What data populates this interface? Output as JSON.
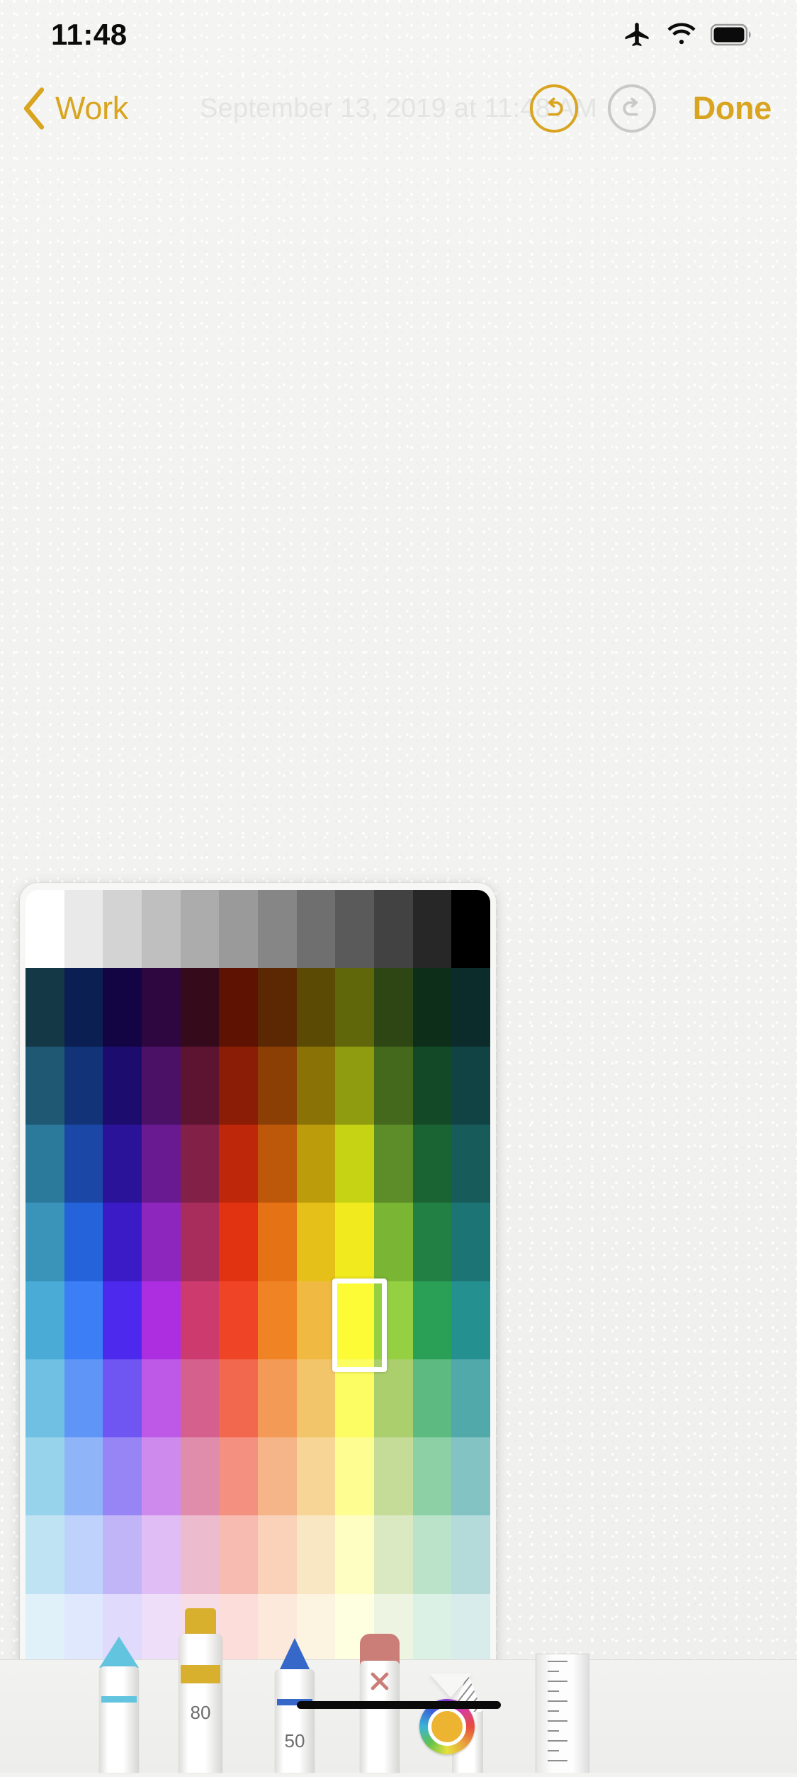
{
  "statusbar": {
    "time": "11:48",
    "icons": [
      "airplane-mode-icon",
      "wifi-icon",
      "battery-icon"
    ]
  },
  "navbar": {
    "back_label": "Work",
    "back_icon": "chevron-left-icon",
    "undo_icon": "undo-arrow-icon",
    "undo_color": "#d9a520",
    "undo_enabled": "true",
    "redo_icon": "redo-arrow-icon",
    "redo_color": "#c9c9c9",
    "redo_enabled": "false",
    "done_label": "Done",
    "accent_color": "#d9a520"
  },
  "note": {
    "timestamp": "September 13, 2019 at 11:48 AM",
    "body": ""
  },
  "color_picker": {
    "columns": 12,
    "rows": 10,
    "selected_index": {
      "row": 5,
      "col": 8
    },
    "selected_color": "#f0b942",
    "grid": [
      [
        "#ffffff",
        "#e9e9e9",
        "#d3d3d3",
        "#bfbfbf",
        "#acacac",
        "#9a9a9a",
        "#868686",
        "#6f6f6f",
        "#5a5a5a",
        "#424242",
        "#272727",
        "#000000"
      ],
      [
        "#143846",
        "#0b1f52",
        "#130544",
        "#2e0740",
        "#350a1b",
        "#5e1202",
        "#5b2803",
        "#5a4a04",
        "#60660a",
        "#2d4613",
        "#0d2f1a",
        "#0c2c2c"
      ],
      [
        "#1f5872",
        "#123377",
        "#1c0c6e",
        "#4a1166",
        "#5c1431",
        "#8b1c05",
        "#8b3f05",
        "#8a7206",
        "#909c0f",
        "#44691d",
        "#134926",
        "#114344"
      ],
      [
        "#2b7a9c",
        "#1b48a7",
        "#2a1299",
        "#6a1a90",
        "#822047",
        "#be2709",
        "#bd570a",
        "#bd9c0c",
        "#c6d314",
        "#5c8d28",
        "#1a6434",
        "#175b5b"
      ],
      [
        "#3a93b8",
        "#2463d9",
        "#3a1bc6",
        "#8c26bc",
        "#a82d5c",
        "#e13312",
        "#e57214",
        "#e5c019",
        "#f0ea1f",
        "#7ab533",
        "#228044",
        "#1d7474"
      ],
      [
        "#49abd6",
        "#3b7ef5",
        "#4c29ec",
        "#ac2ee0",
        "#cd3a6e",
        "#ef4426",
        "#f08424",
        "#f0b942",
        "#fcfb35",
        "#95d042",
        "#2aa057",
        "#249090"
      ],
      [
        "#6fc0e3",
        "#5f95f7",
        "#6f55f2",
        "#bd58e7",
        "#d6608d",
        "#f1684f",
        "#f39a57",
        "#f3c56a",
        "#fcfc63",
        "#accf6d",
        "#5dbb81",
        "#52a9a9"
      ],
      [
        "#97d3eb",
        "#8fb4f8",
        "#9785f5",
        "#cf8aed",
        "#e08cab",
        "#f49080",
        "#f6b489",
        "#f6d596",
        "#fdfd92",
        "#c4dc98",
        "#8dd0a6",
        "#84c3c3"
      ],
      [
        "#c0e3f3",
        "#bed2fb",
        "#c1b5f8",
        "#e0bdf4",
        "#ecbbcd",
        "#f8bbb2",
        "#f9d2b9",
        "#f9e6c2",
        "#fefec2",
        "#dbe9c3",
        "#bbe3ca",
        "#b5dada"
      ],
      [
        "#e0f1f9",
        "#dfe8fd",
        "#e0dafc",
        "#efdef9",
        "#f6dde6",
        "#fcddd9",
        "#fce9dc",
        "#fcf3e1",
        "#fefee1",
        "#edf4e2",
        "#dcf1e5",
        "#d9ecec"
      ]
    ]
  },
  "toolbar": {
    "tools": [
      {
        "name": "pen-tool",
        "icon": "pen-icon",
        "color": "#63c4e0",
        "size": ""
      },
      {
        "name": "highlighter-tool",
        "icon": "highlighter-icon",
        "color": "#d9b02e",
        "size": "80"
      },
      {
        "name": "pencil-tool",
        "icon": "pencil-icon",
        "color": "#3568c8",
        "size": "50"
      },
      {
        "name": "eraser-tool",
        "icon": "eraser-icon",
        "color": "#cb7d78",
        "size": ""
      },
      {
        "name": "lasso-tool",
        "icon": "lasso-select-icon",
        "color": "#8d8d8d",
        "size": ""
      },
      {
        "name": "ruler-tool",
        "icon": "ruler-icon",
        "color": "#9a9a9a",
        "size": ""
      }
    ],
    "color_wheel": {
      "name": "color-wheel-button",
      "icon": "color-wheel-icon",
      "current_color": "#edb431"
    }
  }
}
